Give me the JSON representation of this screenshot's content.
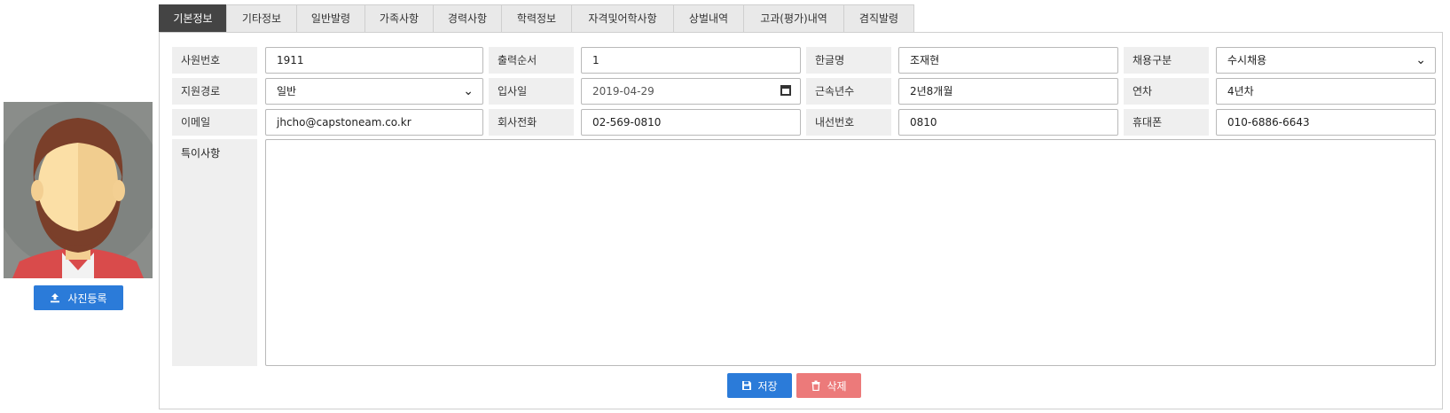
{
  "photo": {
    "upload_label": "사진등록",
    "avatar_bg": "#8a8d8a"
  },
  "tabs": [
    {
      "label": "기본정보",
      "active": true
    },
    {
      "label": "기타정보"
    },
    {
      "label": "일반발령"
    },
    {
      "label": "가족사항"
    },
    {
      "label": "경력사항"
    },
    {
      "label": "학력정보"
    },
    {
      "label": "자격및어학사항"
    },
    {
      "label": "상벌내역"
    },
    {
      "label": "고과(평가)내역"
    },
    {
      "label": "겸직발령"
    }
  ],
  "form": {
    "emp_no": {
      "label": "사원번호",
      "value": "1911"
    },
    "print_order": {
      "label": "출력순서",
      "value": "1"
    },
    "kor_name": {
      "label": "한글명",
      "value": "조재현"
    },
    "hire_type": {
      "label": "채용구분",
      "value": "수시채용"
    },
    "apply_route": {
      "label": "지원경로",
      "value": "일반"
    },
    "join_date": {
      "label": "입사일",
      "value": "2019-04-29"
    },
    "tenure": {
      "label": "근속년수",
      "value": "2년8개월"
    },
    "year_grade": {
      "label": "연차",
      "value": "4년차"
    },
    "email": {
      "label": "이메일",
      "value": "jhcho@capstoneam.co.kr"
    },
    "company_phone": {
      "label": "회사전화",
      "value": "02-569-0810"
    },
    "extension": {
      "label": "내선번호",
      "value": "0810"
    },
    "mobile": {
      "label": "휴대폰",
      "value": "010-6886-6643"
    },
    "remarks": {
      "label": "특이사항",
      "value": ""
    }
  },
  "actions": {
    "save_label": "저장",
    "delete_label": "삭제"
  },
  "colors": {
    "primary": "#2b7bd9",
    "danger": "#ec7a7a",
    "active_tab": "#444444"
  }
}
